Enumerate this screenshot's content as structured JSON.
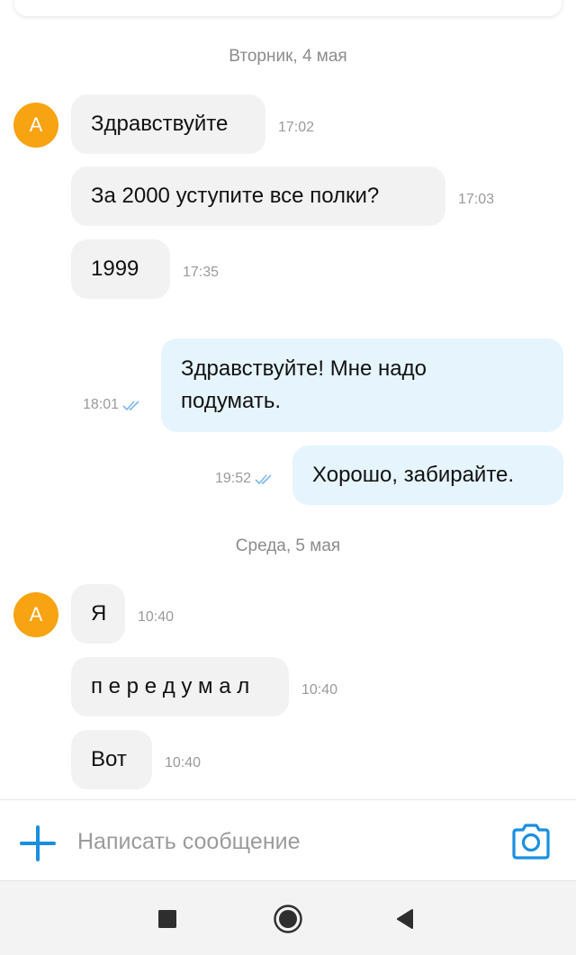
{
  "dates": {
    "tuesday": "Вторник, 4 мая",
    "wednesday": "Среда, 5 мая"
  },
  "contact": {
    "avatar_letter": "А",
    "avatar_color": "#f7a312"
  },
  "messages": [
    {
      "direction": "in",
      "text": "Здравствуйте",
      "time": "17:02"
    },
    {
      "direction": "in",
      "text": "За 2000 уступите все полки?",
      "time": "17:03"
    },
    {
      "direction": "in",
      "text": "1999",
      "time": "17:35"
    },
    {
      "direction": "out",
      "text": "Здравствуйте! Мне надо подумать.",
      "time": "18:01",
      "status": "read"
    },
    {
      "direction": "out",
      "text": "Хорошо, забирайте.",
      "time": "19:52",
      "status": "read"
    },
    {
      "direction": "in",
      "text": "Я",
      "time": "10:40"
    },
    {
      "direction": "in",
      "text": "п е р е д у м а л",
      "time": "10:40"
    },
    {
      "direction": "in",
      "text": "Вот",
      "time": "10:40"
    }
  ],
  "composer": {
    "placeholder": "Написать сообщение",
    "accent_color": "#1a8fe0"
  },
  "colors": {
    "incoming_bubble": "#f2f2f2",
    "outgoing_bubble": "#e5f4fd",
    "read_ticks": "#7fb6e6"
  },
  "icons": {
    "add": "plus-icon",
    "camera": "camera-icon",
    "nav_recent": "square-icon",
    "nav_home": "circle-icon",
    "nav_back": "triangle-back-icon"
  }
}
